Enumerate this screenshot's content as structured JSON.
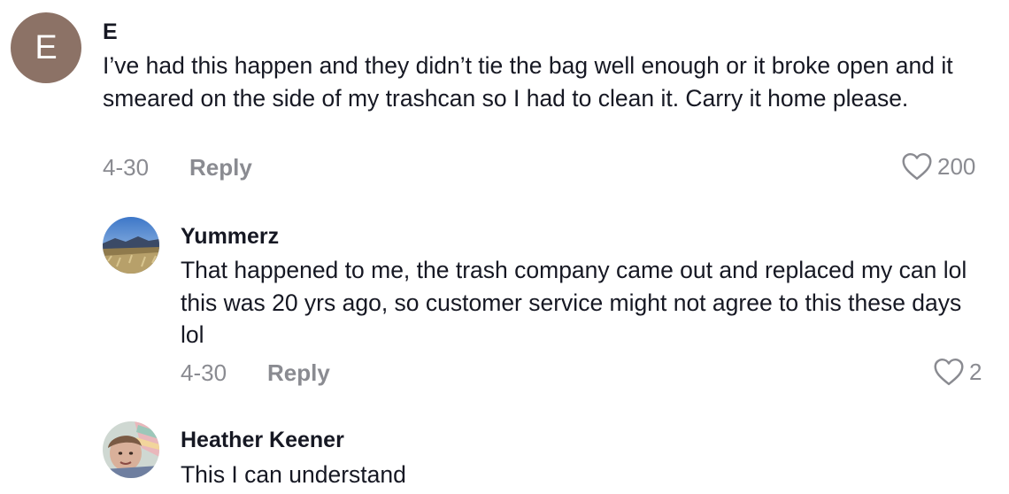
{
  "comments": [
    {
      "avatar_letter": "E",
      "username": "E",
      "text": "I’ve had this happen and they didn’t tie the bag well enough or it broke open and it smeared on the side of my trashcan so I had to clean it. Carry it home please.",
      "date": "4-30",
      "reply_label": "Reply",
      "likes": "200"
    },
    {
      "username": "Yummerz",
      "text": "That happened to me, the trash company came out and replaced my can lol this was 20 yrs ago, so customer service might not agree to this these days lol",
      "date": "4-30",
      "reply_label": "Reply",
      "likes": "2"
    },
    {
      "username": "Heather Keener",
      "text": "This I can understand"
    }
  ],
  "icons": {
    "like": "heart-outline-icon"
  },
  "colors": {
    "primary_text": "#161823",
    "secondary_text": "#8a8b91",
    "avatar_e_bg": "#8c7266"
  }
}
